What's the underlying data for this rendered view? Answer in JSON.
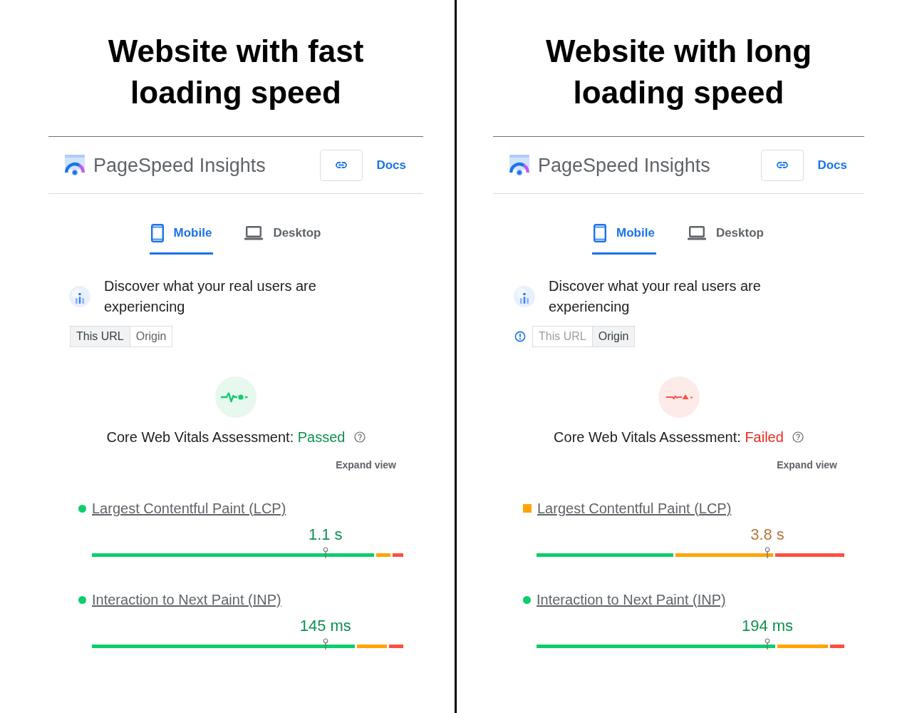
{
  "comparisons": [
    {
      "heading": "Website with fast loading speed",
      "app_title": "PageSpeed Insights",
      "docs_link": "Docs",
      "tabs": [
        {
          "label": "Mobile",
          "kind": "phone",
          "selected": true
        },
        {
          "label": "Desktop",
          "kind": "laptop",
          "selected": false
        }
      ],
      "field_data": {
        "heading": "Discover what your real users are experiencing",
        "options": [
          {
            "label": "This URL",
            "selected": true,
            "disabled": false
          },
          {
            "label": "Origin",
            "selected": false,
            "disabled": false
          }
        ]
      },
      "assessment": {
        "label": "Core Web Vitals Assessment:",
        "result": "Passed",
        "kind": "passed"
      },
      "expand_link": "Expand view",
      "metrics": [
        {
          "name": "Largest Contentful Paint (LCP)",
          "kind": "good",
          "color": "#0cce6b",
          "value": "1.1 s",
          "marker": {
            "level": 0.75
          }
        },
        {
          "name": "Interaction to Next Paint (INP)",
          "kind": "good",
          "color": "#0cce6b",
          "value": "145 ms",
          "marker": {
            "level": 0.75
          }
        }
      ]
    },
    {
      "heading": "Website with long loading speed",
      "app_title": "PageSpeed Insights",
      "docs_link": "Docs",
      "tabs": [
        {
          "label": "Mobile",
          "kind": "phone",
          "selected": true
        },
        {
          "label": "Desktop",
          "kind": "laptop",
          "selected": false
        }
      ],
      "field_data": {
        "heading": "Discover what your real users are experiencing",
        "info": true,
        "options": [
          {
            "label": "This URL",
            "selected": false,
            "disabled": true
          },
          {
            "label": "Origin",
            "selected": true,
            "disabled": false
          }
        ]
      },
      "assessment": {
        "label": "Core Web Vitals Assessment:",
        "result": "Failed",
        "kind": "failed"
      },
      "expand_link": "Expand view",
      "metrics": [
        {
          "name": "Largest Contentful Paint (LCP)",
          "kind": "average",
          "color": "#ffa400",
          "value": "3.8 s",
          "marker": {
            "level": 0.75
          }
        },
        {
          "name": "Interaction to Next Paint (INP)",
          "kind": "good",
          "color": "#0cce6b",
          "value": "194 ms",
          "marker": {
            "level": 0.75
          }
        }
      ]
    }
  ]
}
